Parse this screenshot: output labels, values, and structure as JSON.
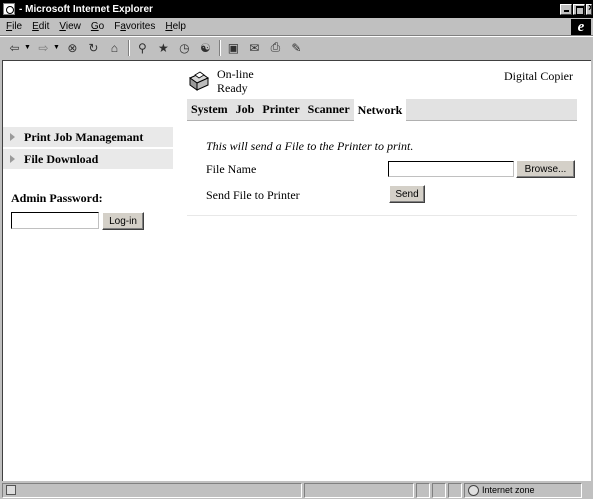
{
  "window": {
    "title": " - Microsoft Internet Explorer"
  },
  "menubar": {
    "items": [
      {
        "first": "F",
        "rest": "ile"
      },
      {
        "first": "E",
        "rest": "dit"
      },
      {
        "first": "V",
        "rest": "iew"
      },
      {
        "first": "G",
        "rest": "o"
      },
      {
        "first": "",
        "rest": "F",
        "tail": "a",
        "after": "vorites"
      },
      {
        "first": "H",
        "rest": "elp"
      }
    ],
    "labels": [
      "File",
      "Edit",
      "View",
      "Go",
      "Favorites",
      "Help"
    ]
  },
  "toolbar": {
    "icons": [
      "back-icon",
      "forward-icon",
      "stop-icon",
      "refresh-icon",
      "home-icon",
      "search-icon",
      "favorites-icon",
      "history-icon",
      "channels-icon",
      "fullscreen-icon",
      "mail-icon",
      "print-icon",
      "edit-icon"
    ]
  },
  "device": {
    "status_line1": "On-line",
    "status_line2": "Ready",
    "model": "Digital Copier"
  },
  "tabs": [
    "System",
    "Job",
    "Printer",
    "Scanner",
    "Network"
  ],
  "sidebar": {
    "items": [
      {
        "label": "Print Job Managemant"
      },
      {
        "label": "File Download"
      }
    ],
    "admin_label": "Admin Password:",
    "login_button": "Log-in",
    "password_value": ""
  },
  "main": {
    "intro": "This will send a File to the Printer to print.",
    "file_name_label": "File Name",
    "file_name_value": "",
    "browse_button": "Browse...",
    "send_label": "Send File to Printer",
    "send_button": "Send"
  },
  "statusbar": {
    "zone": "Internet zone"
  }
}
